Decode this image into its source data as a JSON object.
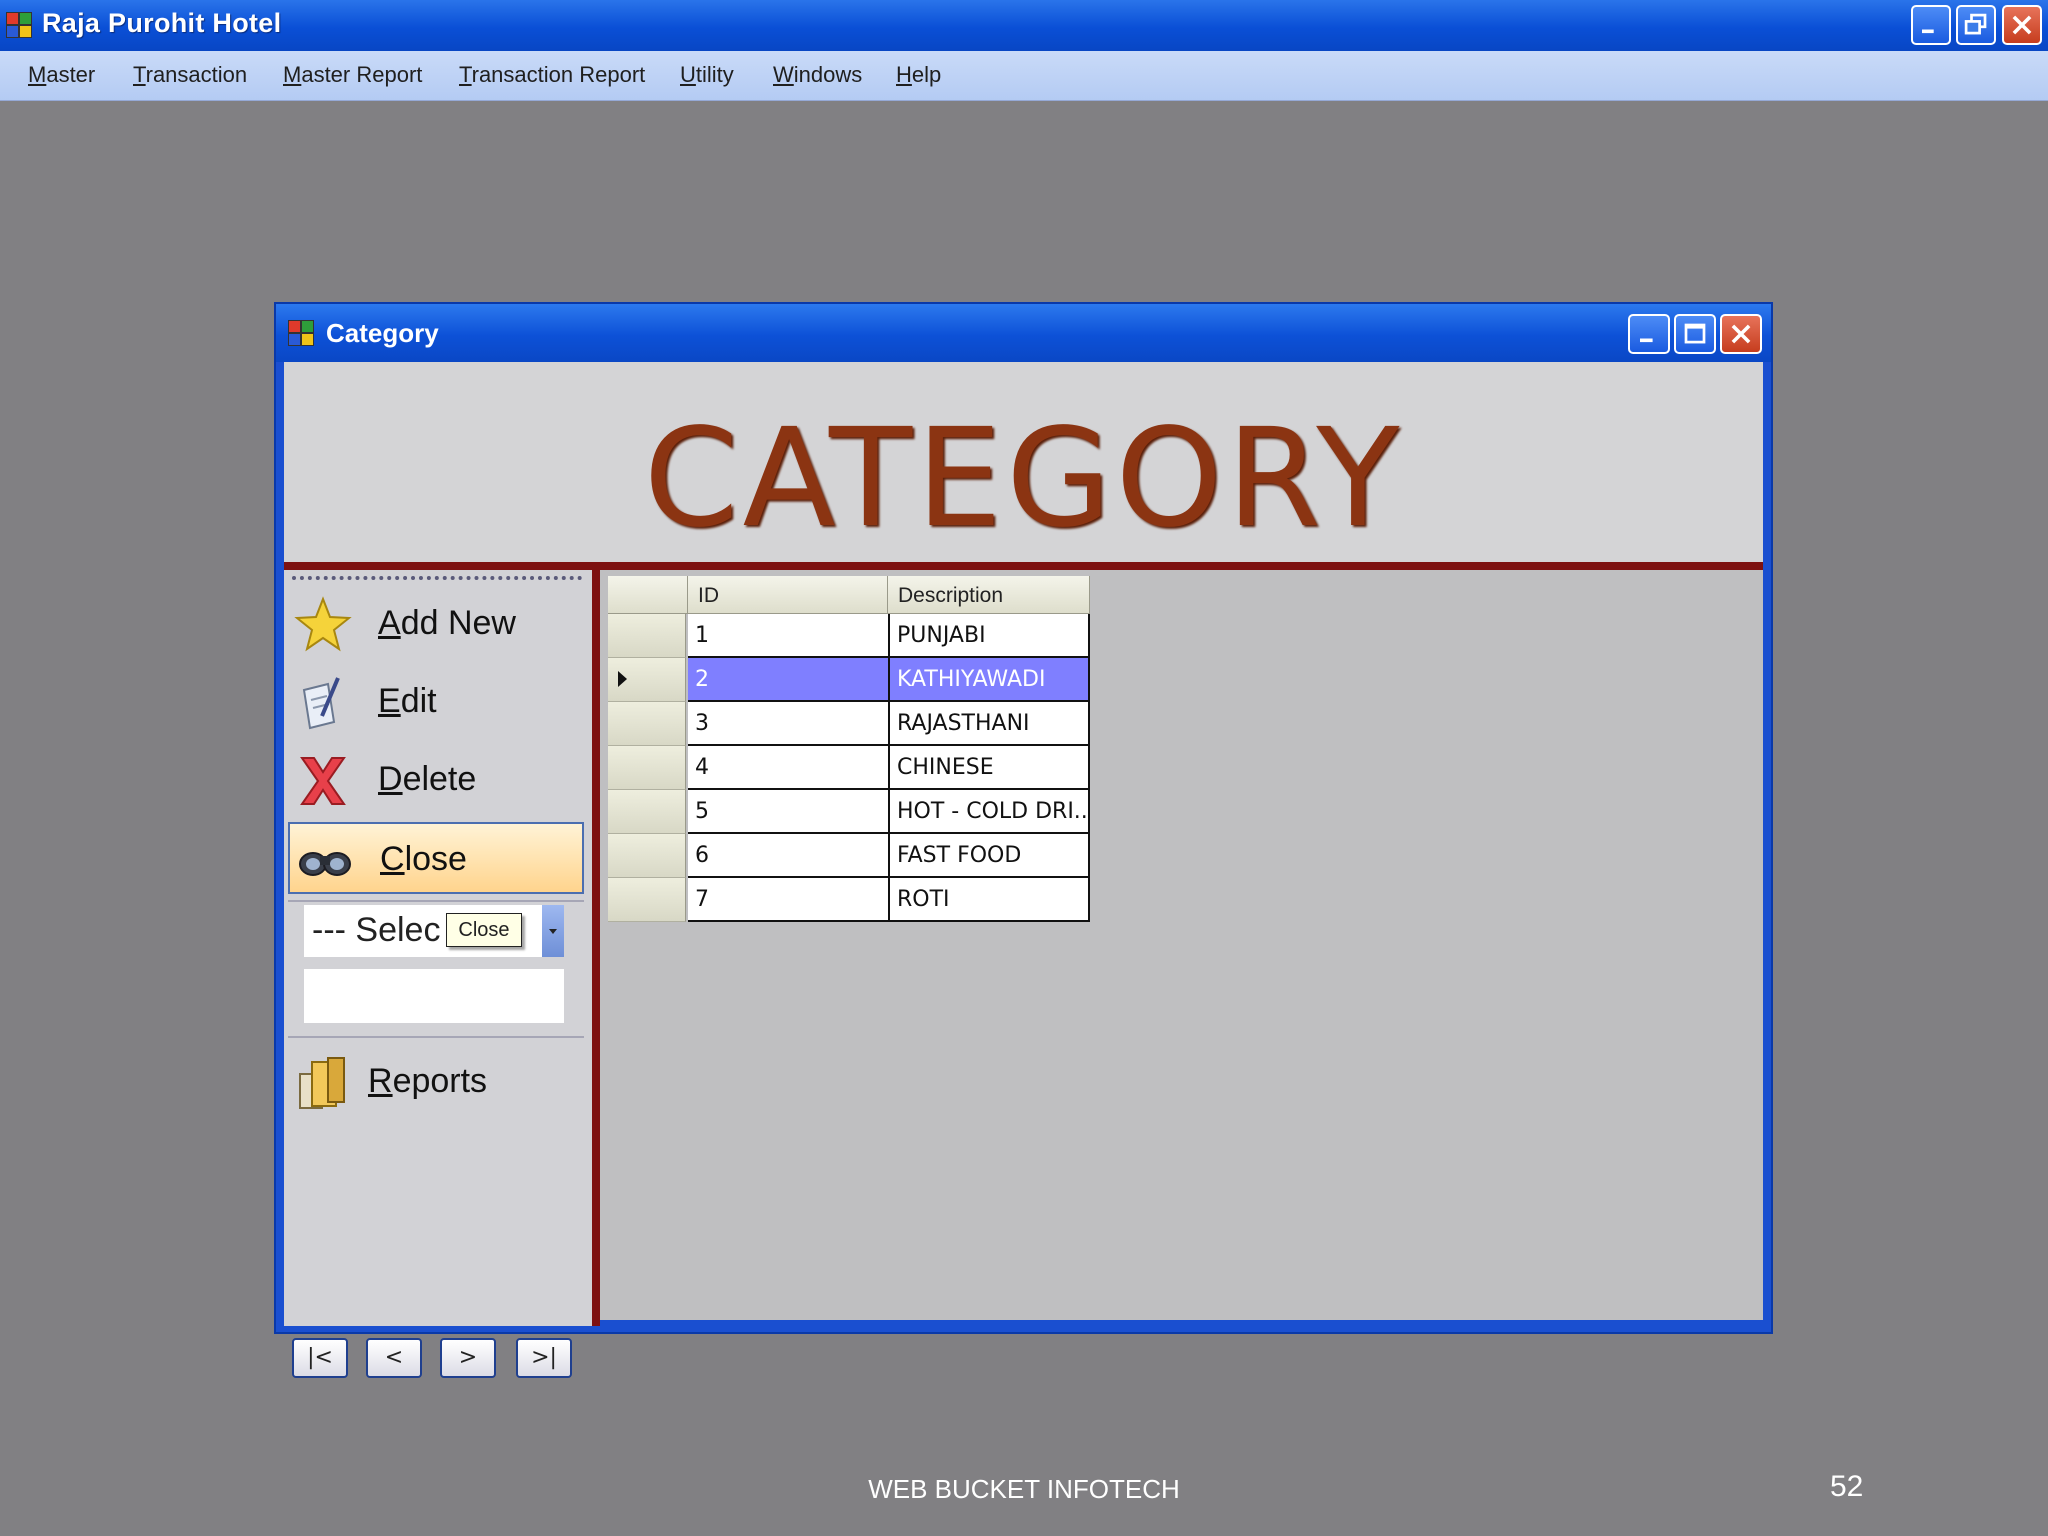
{
  "app": {
    "title": "Raja Purohit Hotel"
  },
  "menu": [
    "Master",
    "Transaction",
    "Master Report",
    "Transaction Report",
    "Utility",
    "Windows",
    "Help"
  ],
  "window": {
    "title": "Category",
    "banner": "CATEGORY"
  },
  "toolbar": {
    "add_new": "Add New",
    "edit": "Edit",
    "delete": "Delete",
    "close": "Close",
    "reports": "Reports"
  },
  "combo": {
    "value": "--- Selec",
    "tooltip": "Close"
  },
  "grid": {
    "columns": [
      "ID",
      "Description"
    ],
    "rows": [
      {
        "id": "1",
        "description": "PUNJABI"
      },
      {
        "id": "2",
        "description": "KATHIYAWADI"
      },
      {
        "id": "3",
        "description": "RAJASTHANI"
      },
      {
        "id": "4",
        "description": "CHINESE"
      },
      {
        "id": "5",
        "description": "HOT - COLD DRI..."
      },
      {
        "id": "6",
        "description": "FAST FOOD"
      },
      {
        "id": "7",
        "description": "ROTI"
      }
    ],
    "selected_index": 1
  },
  "nav": {
    "first": "|<",
    "prev": "<",
    "next": ">",
    "last": ">|"
  },
  "footer": {
    "company": "WEB BUCKET INFOTECH",
    "page": "52"
  },
  "colors": {
    "title_bar": "#0a4fd6",
    "banner_text": "#8b3412",
    "divider": "#7d1111",
    "selection": "#7f7fff",
    "active_button": "#ffd48d"
  },
  "icons": [
    "app-window-icon",
    "star-icon",
    "edit-document-icon",
    "delete-x-icon",
    "binoculars-icon",
    "reports-book-icon"
  ]
}
